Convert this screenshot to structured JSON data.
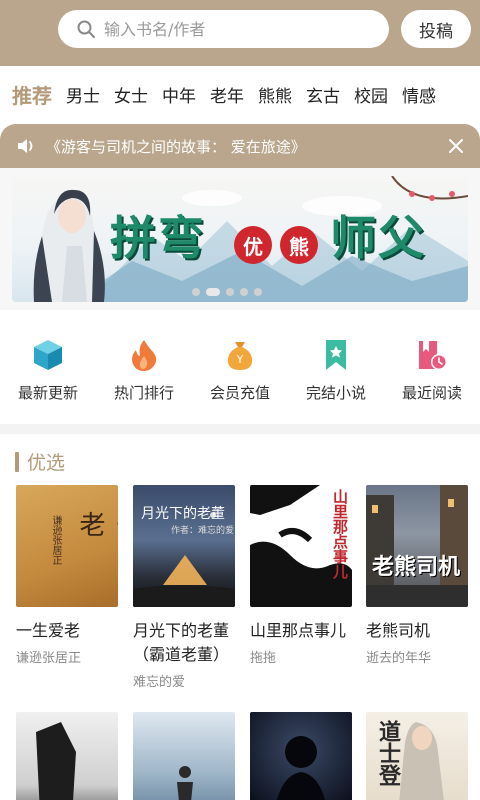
{
  "header": {
    "search_placeholder": "输入书名/作者",
    "submit_label": "投稿"
  },
  "tabs": [
    "推荐",
    "男士",
    "女士",
    "中年",
    "老年",
    "熊熊",
    "玄古",
    "校园",
    "情感"
  ],
  "notice": {
    "text": "《游客与司机之间的故事： 爱在旅途》"
  },
  "banner": {
    "title_left": "拼弯",
    "badge_1": "优",
    "badge_2": "熊",
    "title_right": "师父",
    "dots_count": 5,
    "active_dot": 1
  },
  "quick_actions": [
    {
      "label": "最新更新",
      "icon": "cube-icon",
      "color": "#3fb6d6"
    },
    {
      "label": "热门排行",
      "icon": "flame-icon",
      "color": "#f07a3a"
    },
    {
      "label": "会员充值",
      "icon": "money-bag-icon",
      "color": "#f2a73a"
    },
    {
      "label": "完结小说",
      "icon": "bookmark-icon",
      "color": "#3dbba0"
    },
    {
      "label": "最近阅读",
      "icon": "book-clock-icon",
      "color": "#e8597e"
    }
  ],
  "section": {
    "title": "优选"
  },
  "books": [
    {
      "title": "一生爱老",
      "author": "谦逊张居正",
      "cover_text": "一生爱老",
      "cover_sub": "谦逊张居正"
    },
    {
      "title": "月光下的老董（霸道老董）",
      "author": "难忘的爱",
      "cover_text": "月光下的老董",
      "cover_sub": "作者：难忘的爱"
    },
    {
      "title": "山里那点事儿",
      "author": "拖拖",
      "cover_text": "山里那点事儿"
    },
    {
      "title": "老熊司机",
      "author": "逝去的年华",
      "cover_text": "老熊司机"
    }
  ],
  "books_row2": [
    {
      "cover_text": ""
    },
    {
      "cover_text": ""
    },
    {
      "cover_text": ""
    },
    {
      "cover_text": "道士登"
    }
  ],
  "colors": {
    "header": "#b9a68c",
    "accent": "#b49a78"
  }
}
